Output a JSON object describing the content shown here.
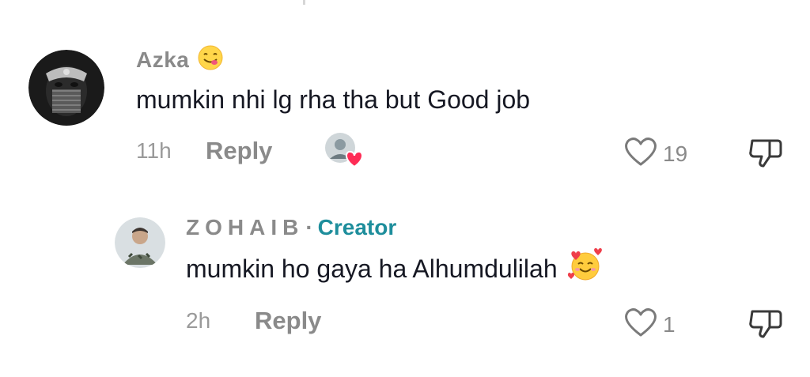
{
  "comments": [
    {
      "author": "Azka",
      "author_emoji": "yum-face-emoji",
      "text": "mumkin nhi lg rha tha but Good job",
      "time": "11h",
      "reply_label": "Reply",
      "liked_by_creator": true,
      "likes": "19"
    }
  ],
  "replies": [
    {
      "author": "ZOHAIB",
      "separator": "·",
      "badge": "Creator",
      "text": "mumkin ho gaya ha Alhumdulilah",
      "text_emoji": "smiling-face-with-hearts-emoji",
      "time": "2h",
      "reply_label": "Reply",
      "likes": "1"
    }
  ],
  "colors": {
    "text": "#161823",
    "muted": "#8a8a8a",
    "creator": "#1e8e9c",
    "heart": "#fe2c55"
  }
}
